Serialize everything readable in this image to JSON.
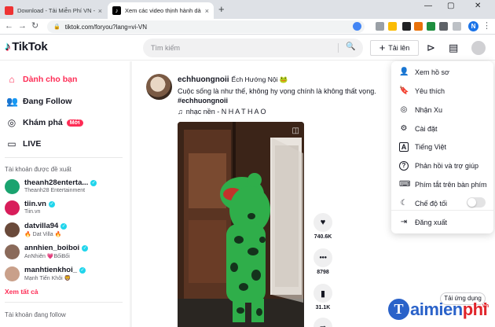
{
  "browser": {
    "tabs": [
      {
        "title": "Download - Tải Miễn Phí VN - Ph",
        "close": "×"
      },
      {
        "title": "Xem các video thịnh hành dà",
        "close": "×"
      }
    ],
    "new_tab": "+",
    "url": "tiktok.com/foryou?lang=vi-VN",
    "profile_initial": "N",
    "win_controls": [
      "—",
      "▢",
      "✕"
    ]
  },
  "header": {
    "logo": "TikTok",
    "search_placeholder": "Tìm kiếm",
    "upload_label": "Tải lên"
  },
  "sidebar": {
    "nav": [
      {
        "label": "Dành cho bạn",
        "icon": "⌂"
      },
      {
        "label": "Đang Follow",
        "icon": "👥"
      },
      {
        "label": "Khám phá",
        "icon": "◎",
        "badge": "Mới"
      },
      {
        "label": "LIVE",
        "icon": "▭"
      }
    ],
    "suggested_title": "Tài khoản được đề xuất",
    "accounts": [
      {
        "username": "theanh28enterta...",
        "display": "Theanh28 Entertainment",
        "color": "#1aa36f"
      },
      {
        "username": "tiin.vn",
        "display": "Tiin.vn",
        "color": "#d81d5a"
      },
      {
        "username": "datvilla94",
        "display": "🔥 Dat Villa 🔥",
        "color": "#6a4a3a"
      },
      {
        "username": "annhien_boiboi",
        "display": "AnNhiên 💗BốiBối",
        "color": "#8a6a5a"
      },
      {
        "username": "manhtienkhoi_",
        "display": "Mạnh Tiến Khôi 🦁",
        "color": "#c9a08a"
      }
    ],
    "see_all": "Xem tất cả",
    "following_title": "Tài khoản đang follow"
  },
  "post": {
    "username": "echhuongnoii",
    "nickname": "Ếch Hướng Nội 🐸",
    "caption": "Cuộc sống là như thế, không hy vọng chính là không thất vọng.",
    "hashtag": "#echhuongnoii",
    "music": "nhạc nền - N H A T H A O",
    "actions": [
      {
        "icon": "♥",
        "count": "740.6K"
      },
      {
        "icon": "●●●",
        "count": "8798"
      },
      {
        "icon": "▮",
        "count": "31.1K"
      }
    ]
  },
  "menu": {
    "items": [
      {
        "label": "Xem hồ sơ",
        "icon": "👤"
      },
      {
        "label": "Yêu thích",
        "icon": "🔖"
      },
      {
        "label": "Nhận Xu",
        "icon": "◎"
      },
      {
        "label": "Cài đặt",
        "icon": "⚙"
      },
      {
        "label": "Tiếng Việt",
        "icon": "A"
      },
      {
        "label": "Phản hồi và trợ giúp",
        "icon": "?"
      },
      {
        "label": "Phím tắt trên bàn phím",
        "icon": "⌨"
      },
      {
        "label": "Chế độ tối",
        "icon": "☾"
      },
      {
        "label": "Đăng xuất",
        "icon": "⇥"
      }
    ],
    "dark_mode_on": false
  },
  "footer": {
    "app_button": "Tải ứng dụng",
    "watermark_t": "T",
    "watermark_a": "aimien",
    "watermark_b": "phi",
    "watermark_vn": ".vn"
  }
}
